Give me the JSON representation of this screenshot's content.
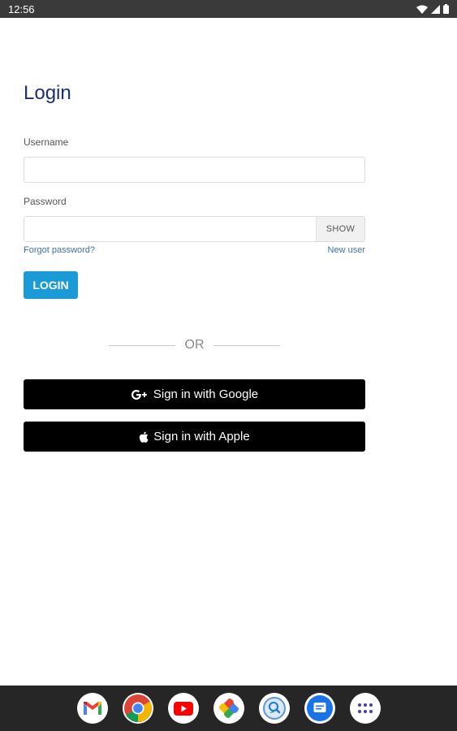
{
  "status_bar": {
    "time": "12:56",
    "icons": [
      "wifi-icon",
      "cell-signal-icon",
      "battery-icon"
    ]
  },
  "login": {
    "title": "Login",
    "username_label": "Username",
    "username_value": "",
    "password_label": "Password",
    "password_value": "",
    "show_label": "SHOW",
    "forgot_label": "Forgot password?",
    "new_user_label": "New user",
    "login_label": "LOGIN"
  },
  "divider": {
    "text": "OR"
  },
  "social": {
    "google_label": "Sign in with Google",
    "apple_label": "Sign in with Apple"
  },
  "dock": {
    "apps": [
      "gmail-icon",
      "chrome-icon",
      "youtube-icon",
      "photos-icon",
      "files-icon",
      "messages-icon",
      "app-drawer-icon"
    ]
  },
  "colors": {
    "title": "#1d2f6f",
    "link": "#3a70b8",
    "login_button": "#1a9bd7",
    "social_button": "#000000",
    "status_bar": "#3a3a3a",
    "dock": "#262626"
  }
}
